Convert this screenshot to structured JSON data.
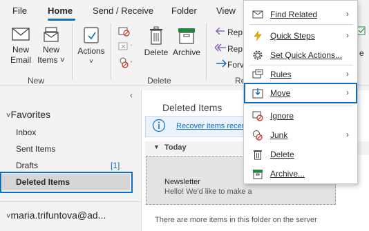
{
  "tabs": [
    {
      "label": "File"
    },
    {
      "label": "Home"
    },
    {
      "label": "Send / Receive"
    },
    {
      "label": "Folder"
    },
    {
      "label": "View"
    }
  ],
  "ribbon": {
    "new_email": "New\nEmail",
    "new_email_l1": "New",
    "new_email_l2": "Email",
    "new_items_l1": "New",
    "new_items_l2": "Items ˅",
    "group_new": "New",
    "actions_label": "Actions",
    "delete_label": "Delete",
    "archive_label": "Archive",
    "group_delete": "Delete",
    "reply_label": "Rep",
    "reply_all_label": "Rep",
    "forward_label": "Forv",
    "group_respond": "Re"
  },
  "context_menu": {
    "items": [
      {
        "label": "Find Related",
        "icon": "find-related-icon",
        "submenu": true
      },
      {
        "label": "Quick Steps",
        "icon": "lightning-icon",
        "submenu": true
      },
      {
        "label": "Set Quick Actions...",
        "icon": "gear-icon",
        "submenu": false
      },
      {
        "label": "Rules",
        "icon": "rules-icon",
        "submenu": true
      },
      {
        "label": "Move",
        "icon": "move-icon",
        "submenu": true,
        "highlighted": true
      },
      {
        "label": "Ignore",
        "icon": "ignore-icon",
        "submenu": false
      },
      {
        "label": "Junk",
        "icon": "junk-icon",
        "submenu": true
      },
      {
        "label": "Delete",
        "icon": "trash-icon",
        "submenu": false
      },
      {
        "label": "Archive...",
        "icon": "archive-icon",
        "submenu": false
      }
    ],
    "arrow": "›"
  },
  "folders": {
    "favorites_label": "Favorites",
    "inbox": "Inbox",
    "sent": "Sent Items",
    "drafts": "Drafts",
    "drafts_count": "[1]",
    "deleted": "Deleted Items",
    "account": "maria.trifuntova@ad..."
  },
  "message_list": {
    "title": "Deleted Items",
    "info_link": "Recover items recer",
    "group_today": "Today",
    "message": {
      "sender": "Newsletter",
      "preview": "Hello!  We'd like to make a"
    },
    "more_items": "There are more items in this folder on the server"
  },
  "colors": {
    "accent": "#0f6cbd",
    "ribbon_bg": "#f3f3f3",
    "selection": "#d6d6d6"
  }
}
